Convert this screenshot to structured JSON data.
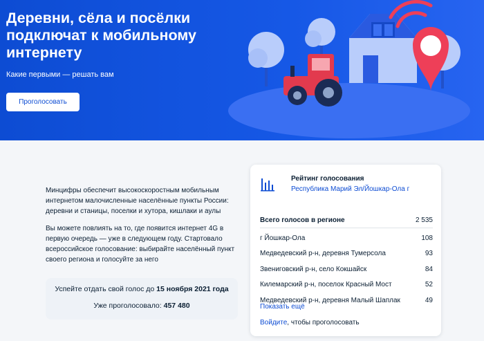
{
  "hero": {
    "title": "Деревни, сёла и посёлки подключат к мобильному интернету",
    "subtitle": "Какие первыми — решать вам",
    "vote_button": "Проголосовать"
  },
  "intro": {
    "paragraph1": "Минцифры обеспечит высокоскоростным мобильным интернетом малочисленные населённые пункты России: деревни и станицы, поселки и хутора, кишлаки и аулы",
    "paragraph2": "Вы можете повлиять на то, где появится интернет 4G в первую очередь — уже в следующем году. Стартовало всероссийское голосование: выбирайте населённый пункт своего региона и голосуйте за него"
  },
  "deadline": {
    "prefix": "Успейте отдать свой голос до ",
    "date": "15 ноября 2021 года",
    "voted_label": "Уже проголосовало: ",
    "voted_count": "457 480"
  },
  "rating": {
    "title": "Рейтинг голосования",
    "region": "Республика Марий Эл/Йошкар-Ола г",
    "icon": "chart-bars-icon",
    "total_label": "Всего голосов в регионе",
    "total_value": "2 535",
    "rows": [
      {
        "name": "г Йошкар-Ола",
        "votes": "108"
      },
      {
        "name": "Медведевский р-н, деревня Тумерсола",
        "votes": "93"
      },
      {
        "name": "Звениговский р-н, село Кокшайск",
        "votes": "84"
      },
      {
        "name": "Килемарский р-н, поселок Красный Мост",
        "votes": "52"
      },
      {
        "name": "Медведевский р-н, деревня Малый Шаплак",
        "votes": "49"
      }
    ],
    "show_more": "Показать ещё",
    "login_link": "Войдите",
    "login_suffix": ", чтобы проголосовать"
  },
  "colors": {
    "brand_blue": "#0d4cd3",
    "pin_red": "#ee3f58",
    "tractor_red": "#e23a4e"
  }
}
